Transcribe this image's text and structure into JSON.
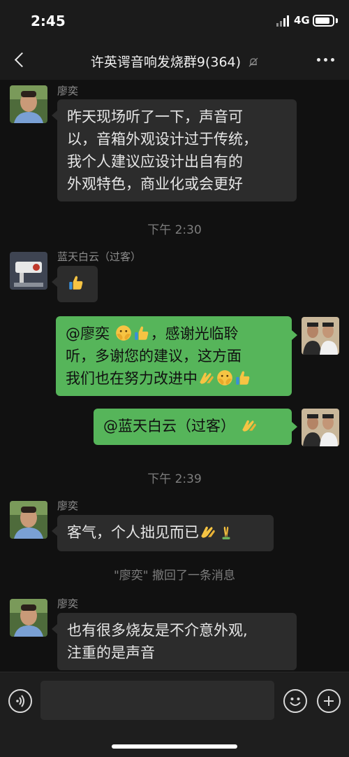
{
  "status_bar": {
    "time": "2:45",
    "network": "4G",
    "battery_level": 0.85
  },
  "header": {
    "title": "许英谔音响发烧群9(364)",
    "back_icon": "chevron-left-icon",
    "mute_icon": "bell-slash-icon",
    "more_icon": "ellipsis-icon"
  },
  "messages": [
    {
      "type": "incoming",
      "sender": "廖奕",
      "lines": [
        "昨天现场听了一下，声音可",
        "以，音箱外观设计过于传统，",
        "我个人建议应设计出自有的",
        "外观特色，商业化或会更好"
      ]
    },
    {
      "type": "time",
      "text": "下午 2:30"
    },
    {
      "type": "incoming",
      "sender": "蓝天白云（过客）",
      "emoji": "thumbs-up"
    },
    {
      "type": "outgoing",
      "line1_text": "@廖奕 ",
      "line1_tail": "，感谢光临聆",
      "line2": "听，多谢您的建议，这方面",
      "line3_text": "我们也在努力改进中"
    },
    {
      "type": "outgoing",
      "text": "@蓝天白云（过客） "
    },
    {
      "type": "time",
      "text": "下午 2:39"
    },
    {
      "type": "incoming",
      "sender": "廖奕",
      "text": "客气，个人拙见而已"
    },
    {
      "type": "system",
      "text": "\"廖奕\" 撤回了一条消息"
    },
    {
      "type": "incoming",
      "sender": "廖奕",
      "lines": [
        "也有很多烧友是不介意外观,",
        "注重的是声音"
      ]
    }
  ],
  "input_bar": {
    "placeholder": "",
    "voice_icon": "voice-icon",
    "emoji_icon": "smiley-icon",
    "plus_icon": "plus-icon"
  },
  "colors": {
    "background": "#111111",
    "bubble_incoming": "#2c2c2c",
    "bubble_outgoing": "#56b55a",
    "secondary_text": "#8e8e8e"
  }
}
